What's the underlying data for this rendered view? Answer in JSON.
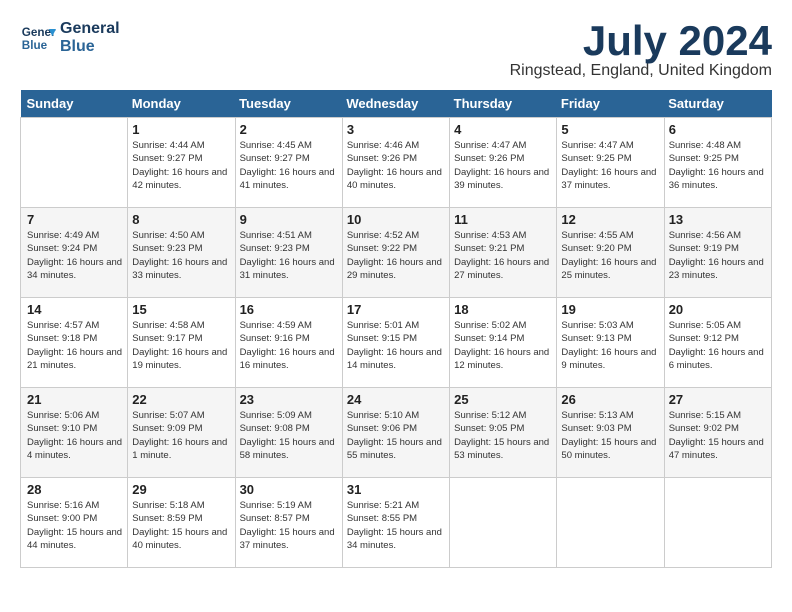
{
  "header": {
    "logo_line1": "General",
    "logo_line2": "Blue",
    "month_year": "July 2024",
    "location": "Ringstead, England, United Kingdom"
  },
  "weekdays": [
    "Sunday",
    "Monday",
    "Tuesday",
    "Wednesday",
    "Thursday",
    "Friday",
    "Saturday"
  ],
  "weeks": [
    [
      null,
      {
        "day": 1,
        "sunrise": "4:44 AM",
        "sunset": "9:27 PM",
        "daylight": "16 hours and 42 minutes."
      },
      {
        "day": 2,
        "sunrise": "4:45 AM",
        "sunset": "9:27 PM",
        "daylight": "16 hours and 41 minutes."
      },
      {
        "day": 3,
        "sunrise": "4:46 AM",
        "sunset": "9:26 PM",
        "daylight": "16 hours and 40 minutes."
      },
      {
        "day": 4,
        "sunrise": "4:47 AM",
        "sunset": "9:26 PM",
        "daylight": "16 hours and 39 minutes."
      },
      {
        "day": 5,
        "sunrise": "4:47 AM",
        "sunset": "9:25 PM",
        "daylight": "16 hours and 37 minutes."
      },
      {
        "day": 6,
        "sunrise": "4:48 AM",
        "sunset": "9:25 PM",
        "daylight": "16 hours and 36 minutes."
      }
    ],
    [
      {
        "day": 7,
        "sunrise": "4:49 AM",
        "sunset": "9:24 PM",
        "daylight": "16 hours and 34 minutes."
      },
      {
        "day": 8,
        "sunrise": "4:50 AM",
        "sunset": "9:23 PM",
        "daylight": "16 hours and 33 minutes."
      },
      {
        "day": 9,
        "sunrise": "4:51 AM",
        "sunset": "9:23 PM",
        "daylight": "16 hours and 31 minutes."
      },
      {
        "day": 10,
        "sunrise": "4:52 AM",
        "sunset": "9:22 PM",
        "daylight": "16 hours and 29 minutes."
      },
      {
        "day": 11,
        "sunrise": "4:53 AM",
        "sunset": "9:21 PM",
        "daylight": "16 hours and 27 minutes."
      },
      {
        "day": 12,
        "sunrise": "4:55 AM",
        "sunset": "9:20 PM",
        "daylight": "16 hours and 25 minutes."
      },
      {
        "day": 13,
        "sunrise": "4:56 AM",
        "sunset": "9:19 PM",
        "daylight": "16 hours and 23 minutes."
      }
    ],
    [
      {
        "day": 14,
        "sunrise": "4:57 AM",
        "sunset": "9:18 PM",
        "daylight": "16 hours and 21 minutes."
      },
      {
        "day": 15,
        "sunrise": "4:58 AM",
        "sunset": "9:17 PM",
        "daylight": "16 hours and 19 minutes."
      },
      {
        "day": 16,
        "sunrise": "4:59 AM",
        "sunset": "9:16 PM",
        "daylight": "16 hours and 16 minutes."
      },
      {
        "day": 17,
        "sunrise": "5:01 AM",
        "sunset": "9:15 PM",
        "daylight": "16 hours and 14 minutes."
      },
      {
        "day": 18,
        "sunrise": "5:02 AM",
        "sunset": "9:14 PM",
        "daylight": "16 hours and 12 minutes."
      },
      {
        "day": 19,
        "sunrise": "5:03 AM",
        "sunset": "9:13 PM",
        "daylight": "16 hours and 9 minutes."
      },
      {
        "day": 20,
        "sunrise": "5:05 AM",
        "sunset": "9:12 PM",
        "daylight": "16 hours and 6 minutes."
      }
    ],
    [
      {
        "day": 21,
        "sunrise": "5:06 AM",
        "sunset": "9:10 PM",
        "daylight": "16 hours and 4 minutes."
      },
      {
        "day": 22,
        "sunrise": "5:07 AM",
        "sunset": "9:09 PM",
        "daylight": "16 hours and 1 minute."
      },
      {
        "day": 23,
        "sunrise": "5:09 AM",
        "sunset": "9:08 PM",
        "daylight": "15 hours and 58 minutes."
      },
      {
        "day": 24,
        "sunrise": "5:10 AM",
        "sunset": "9:06 PM",
        "daylight": "15 hours and 55 minutes."
      },
      {
        "day": 25,
        "sunrise": "5:12 AM",
        "sunset": "9:05 PM",
        "daylight": "15 hours and 53 minutes."
      },
      {
        "day": 26,
        "sunrise": "5:13 AM",
        "sunset": "9:03 PM",
        "daylight": "15 hours and 50 minutes."
      },
      {
        "day": 27,
        "sunrise": "5:15 AM",
        "sunset": "9:02 PM",
        "daylight": "15 hours and 47 minutes."
      }
    ],
    [
      {
        "day": 28,
        "sunrise": "5:16 AM",
        "sunset": "9:00 PM",
        "daylight": "15 hours and 44 minutes."
      },
      {
        "day": 29,
        "sunrise": "5:18 AM",
        "sunset": "8:59 PM",
        "daylight": "15 hours and 40 minutes."
      },
      {
        "day": 30,
        "sunrise": "5:19 AM",
        "sunset": "8:57 PM",
        "daylight": "15 hours and 37 minutes."
      },
      {
        "day": 31,
        "sunrise": "5:21 AM",
        "sunset": "8:55 PM",
        "daylight": "15 hours and 34 minutes."
      },
      null,
      null,
      null
    ]
  ]
}
